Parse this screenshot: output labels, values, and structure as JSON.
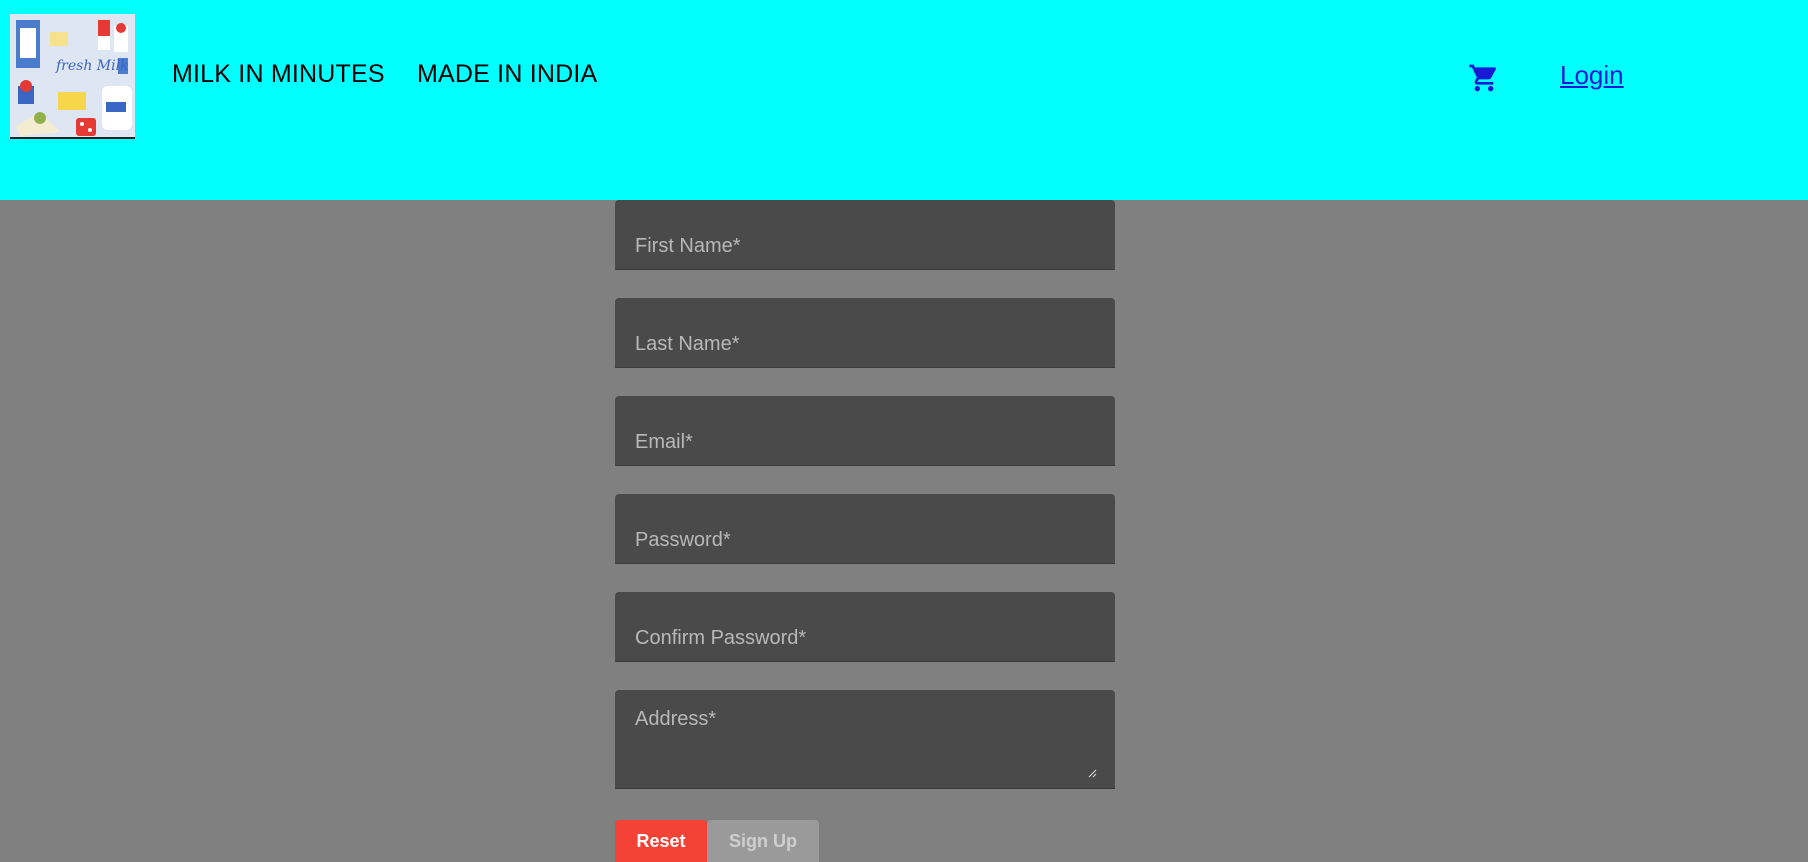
{
  "header": {
    "brand_line_1": "MILK IN MINUTES",
    "brand_line_2": "MADE IN INDIA",
    "cart_icon": "shopping-cart-icon",
    "login_label": "Login",
    "logo_text": "fresh Milk",
    "background": "#00ffff"
  },
  "form": {
    "fields": [
      {
        "placeholder": "First Name*",
        "value": ""
      },
      {
        "placeholder": "Last Name*",
        "value": ""
      },
      {
        "placeholder": "Email*",
        "value": ""
      },
      {
        "placeholder": "Password*",
        "value": ""
      },
      {
        "placeholder": "Confirm Password*",
        "value": ""
      },
      {
        "placeholder": "Address*",
        "value": ""
      }
    ],
    "reset_label": "Reset",
    "signup_label": "Sign Up"
  },
  "colors": {
    "page_background": "#808080",
    "field_background": "#4a4a4a",
    "reset_button": "#f44336",
    "signup_button": "#9a9a9a",
    "login_link": "#1a1ad6"
  }
}
